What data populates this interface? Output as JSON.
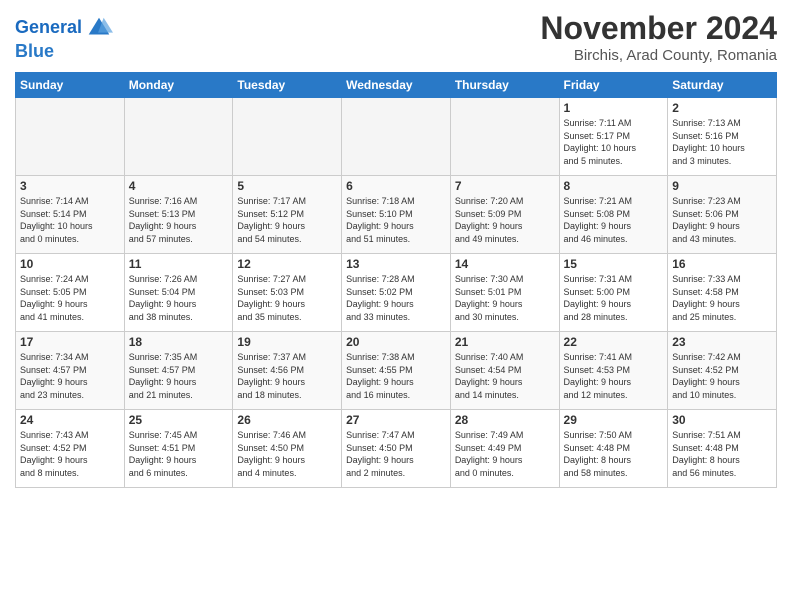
{
  "header": {
    "logo_line1": "General",
    "logo_line2": "Blue",
    "month_title": "November 2024",
    "location": "Birchis, Arad County, Romania"
  },
  "weekdays": [
    "Sunday",
    "Monday",
    "Tuesday",
    "Wednesday",
    "Thursday",
    "Friday",
    "Saturday"
  ],
  "weeks": [
    [
      {
        "day": "",
        "info": ""
      },
      {
        "day": "",
        "info": ""
      },
      {
        "day": "",
        "info": ""
      },
      {
        "day": "",
        "info": ""
      },
      {
        "day": "",
        "info": ""
      },
      {
        "day": "1",
        "info": "Sunrise: 7:11 AM\nSunset: 5:17 PM\nDaylight: 10 hours\nand 5 minutes."
      },
      {
        "day": "2",
        "info": "Sunrise: 7:13 AM\nSunset: 5:16 PM\nDaylight: 10 hours\nand 3 minutes."
      }
    ],
    [
      {
        "day": "3",
        "info": "Sunrise: 7:14 AM\nSunset: 5:14 PM\nDaylight: 10 hours\nand 0 minutes."
      },
      {
        "day": "4",
        "info": "Sunrise: 7:16 AM\nSunset: 5:13 PM\nDaylight: 9 hours\nand 57 minutes."
      },
      {
        "day": "5",
        "info": "Sunrise: 7:17 AM\nSunset: 5:12 PM\nDaylight: 9 hours\nand 54 minutes."
      },
      {
        "day": "6",
        "info": "Sunrise: 7:18 AM\nSunset: 5:10 PM\nDaylight: 9 hours\nand 51 minutes."
      },
      {
        "day": "7",
        "info": "Sunrise: 7:20 AM\nSunset: 5:09 PM\nDaylight: 9 hours\nand 49 minutes."
      },
      {
        "day": "8",
        "info": "Sunrise: 7:21 AM\nSunset: 5:08 PM\nDaylight: 9 hours\nand 46 minutes."
      },
      {
        "day": "9",
        "info": "Sunrise: 7:23 AM\nSunset: 5:06 PM\nDaylight: 9 hours\nand 43 minutes."
      }
    ],
    [
      {
        "day": "10",
        "info": "Sunrise: 7:24 AM\nSunset: 5:05 PM\nDaylight: 9 hours\nand 41 minutes."
      },
      {
        "day": "11",
        "info": "Sunrise: 7:26 AM\nSunset: 5:04 PM\nDaylight: 9 hours\nand 38 minutes."
      },
      {
        "day": "12",
        "info": "Sunrise: 7:27 AM\nSunset: 5:03 PM\nDaylight: 9 hours\nand 35 minutes."
      },
      {
        "day": "13",
        "info": "Sunrise: 7:28 AM\nSunset: 5:02 PM\nDaylight: 9 hours\nand 33 minutes."
      },
      {
        "day": "14",
        "info": "Sunrise: 7:30 AM\nSunset: 5:01 PM\nDaylight: 9 hours\nand 30 minutes."
      },
      {
        "day": "15",
        "info": "Sunrise: 7:31 AM\nSunset: 5:00 PM\nDaylight: 9 hours\nand 28 minutes."
      },
      {
        "day": "16",
        "info": "Sunrise: 7:33 AM\nSunset: 4:58 PM\nDaylight: 9 hours\nand 25 minutes."
      }
    ],
    [
      {
        "day": "17",
        "info": "Sunrise: 7:34 AM\nSunset: 4:57 PM\nDaylight: 9 hours\nand 23 minutes."
      },
      {
        "day": "18",
        "info": "Sunrise: 7:35 AM\nSunset: 4:57 PM\nDaylight: 9 hours\nand 21 minutes."
      },
      {
        "day": "19",
        "info": "Sunrise: 7:37 AM\nSunset: 4:56 PM\nDaylight: 9 hours\nand 18 minutes."
      },
      {
        "day": "20",
        "info": "Sunrise: 7:38 AM\nSunset: 4:55 PM\nDaylight: 9 hours\nand 16 minutes."
      },
      {
        "day": "21",
        "info": "Sunrise: 7:40 AM\nSunset: 4:54 PM\nDaylight: 9 hours\nand 14 minutes."
      },
      {
        "day": "22",
        "info": "Sunrise: 7:41 AM\nSunset: 4:53 PM\nDaylight: 9 hours\nand 12 minutes."
      },
      {
        "day": "23",
        "info": "Sunrise: 7:42 AM\nSunset: 4:52 PM\nDaylight: 9 hours\nand 10 minutes."
      }
    ],
    [
      {
        "day": "24",
        "info": "Sunrise: 7:43 AM\nSunset: 4:52 PM\nDaylight: 9 hours\nand 8 minutes."
      },
      {
        "day": "25",
        "info": "Sunrise: 7:45 AM\nSunset: 4:51 PM\nDaylight: 9 hours\nand 6 minutes."
      },
      {
        "day": "26",
        "info": "Sunrise: 7:46 AM\nSunset: 4:50 PM\nDaylight: 9 hours\nand 4 minutes."
      },
      {
        "day": "27",
        "info": "Sunrise: 7:47 AM\nSunset: 4:50 PM\nDaylight: 9 hours\nand 2 minutes."
      },
      {
        "day": "28",
        "info": "Sunrise: 7:49 AM\nSunset: 4:49 PM\nDaylight: 9 hours\nand 0 minutes."
      },
      {
        "day": "29",
        "info": "Sunrise: 7:50 AM\nSunset: 4:48 PM\nDaylight: 8 hours\nand 58 minutes."
      },
      {
        "day": "30",
        "info": "Sunrise: 7:51 AM\nSunset: 4:48 PM\nDaylight: 8 hours\nand 56 minutes."
      }
    ]
  ]
}
